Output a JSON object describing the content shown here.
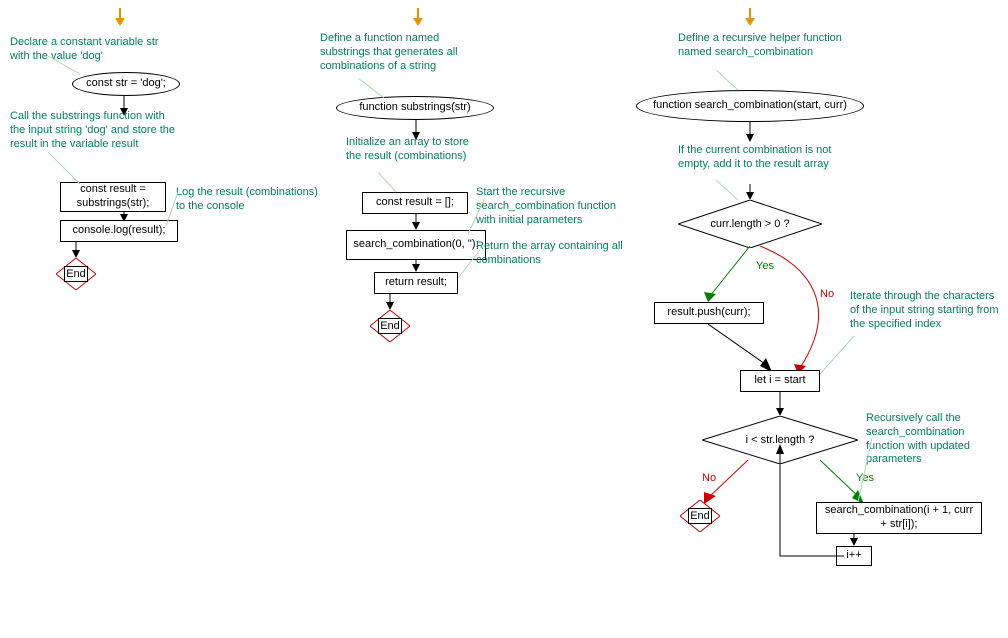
{
  "col1": {
    "annot_declare": "Declare a constant variable str with the value 'dog'",
    "node_const": "const str = 'dog';",
    "annot_call": "Call the substrings function with the input string 'dog' and store the result in the variable result",
    "node_result": "const result = substrings(str);",
    "annot_log": "Log the result (combinations) to the console",
    "node_log": "console.log(result);",
    "end": "End"
  },
  "col2": {
    "annot_define": "Define a function named substrings that generates all combinations of a string",
    "node_func": "function substrings(str)",
    "annot_init": "Initialize an array to store the result (combinations)",
    "node_init": "const result = [];",
    "annot_start": "Start the recursive search_combination function with initial parameters",
    "node_search": "search_combination(0, '');",
    "annot_return": "Return the array containing all combinations",
    "node_return": "return result;",
    "end": "End"
  },
  "col3": {
    "annot_define": "Define a recursive helper function named search_combination",
    "node_func": "function search_combination(start, curr)",
    "annot_ifcurr": "If the current combination is not empty, add it to the result array",
    "decision_len": "curr.length > 0 ?",
    "yes": "Yes",
    "no": "No",
    "node_push": "result.push(curr);",
    "annot_iterate": "Iterate through the characters of the input string starting from the specified index",
    "node_leti": "let i = start",
    "decision_loop": "i < str.length ?",
    "annot_recurse": "Recursively call the search_combination function with updated parameters",
    "node_recurse": "search_combination(i + 1, curr + str[i]);",
    "node_inc": "i++",
    "end": "End"
  }
}
